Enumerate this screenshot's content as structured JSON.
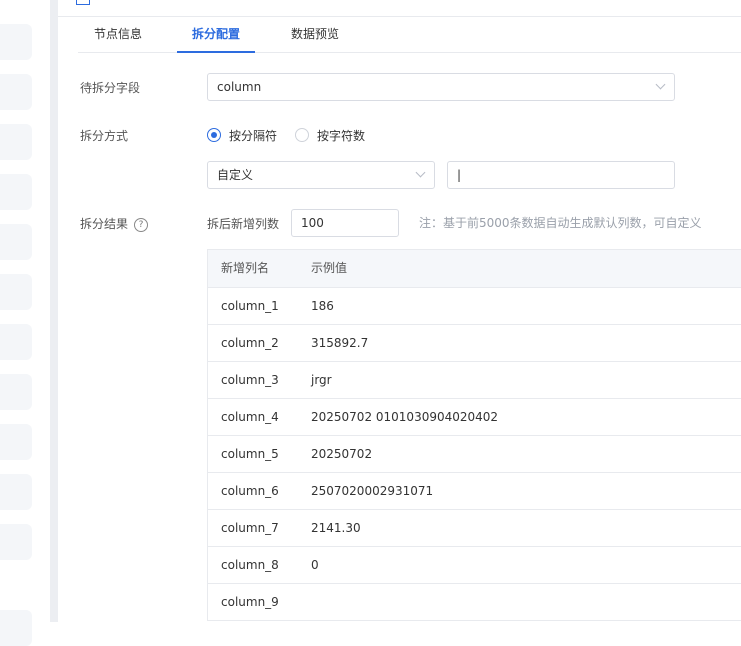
{
  "tabs": [
    {
      "label": "节点信息"
    },
    {
      "label": "拆分配置"
    },
    {
      "label": "数据预览"
    }
  ],
  "form": {
    "field_label": "待拆分字段",
    "field_value": "column",
    "method_label": "拆分方式",
    "radio_delimiter": "按分隔符",
    "radio_charcount": "按字符数",
    "delimiter_type": "自定义",
    "delimiter_value": "|",
    "result_label": "拆分结果",
    "help_icon": "?",
    "newcol_count_label": "拆后新增列数",
    "newcol_count_value": "100",
    "hint": "注：基于前5000条数据自动生成默认列数，可自定义"
  },
  "table": {
    "headers": [
      "新增列名",
      "示例值"
    ],
    "rows": [
      [
        "column_1",
        "186"
      ],
      [
        "column_2",
        "315892.7"
      ],
      [
        "column_3",
        "jrgr"
      ],
      [
        "column_4",
        "20250702 0101030904020402"
      ],
      [
        "column_5",
        "20250702"
      ],
      [
        "column_6",
        "2507020002931071"
      ],
      [
        "column_7",
        "2141.30"
      ],
      [
        "column_8",
        "0"
      ],
      [
        "column_9",
        ""
      ]
    ]
  },
  "colors": {
    "accent": "#2d6cdf"
  }
}
